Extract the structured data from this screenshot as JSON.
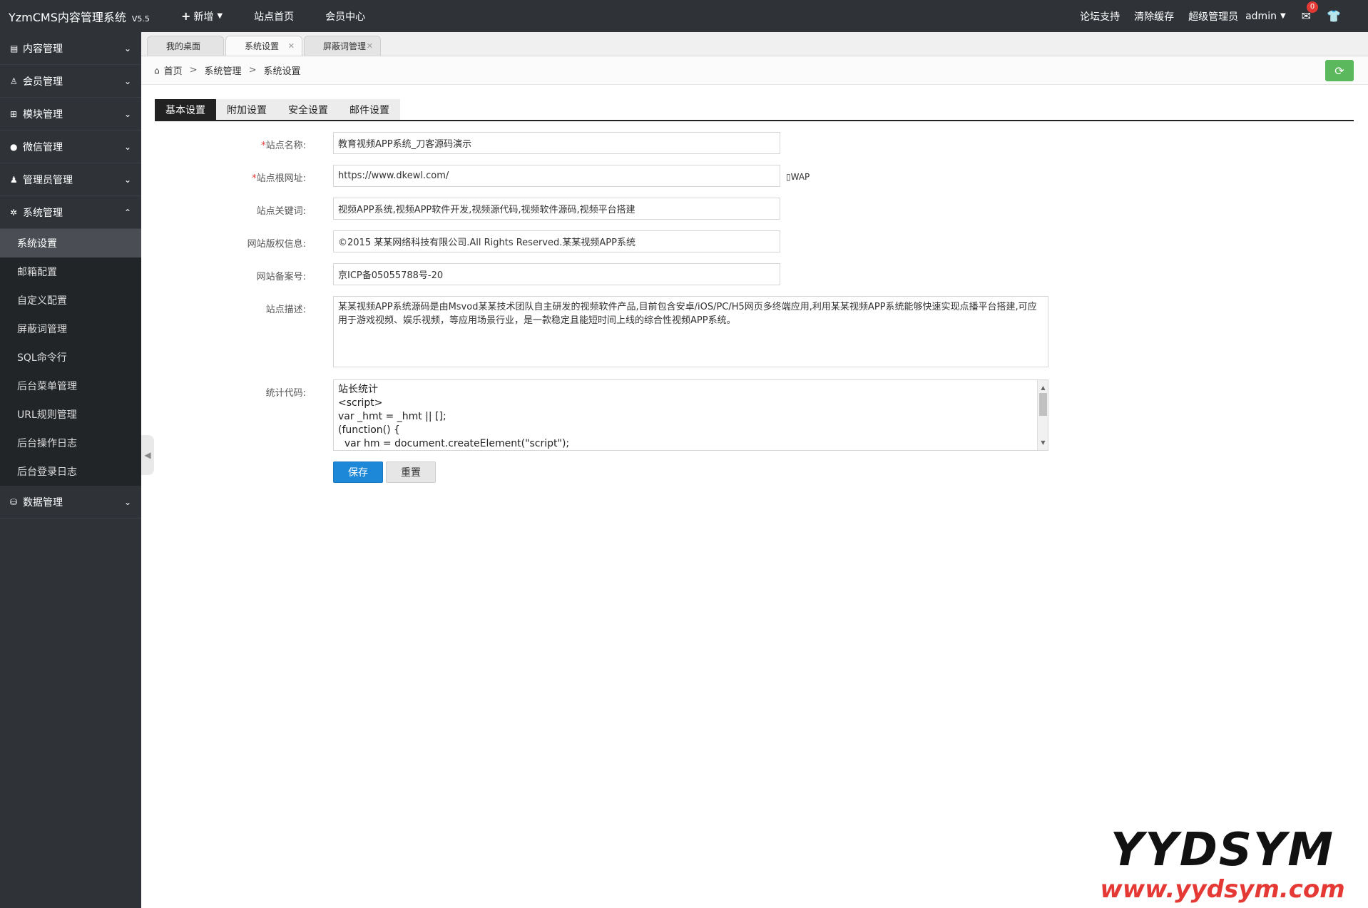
{
  "topbar": {
    "brand": "YzmCMS内容管理系统",
    "version": "V5.5",
    "nav": [
      {
        "label": "新增",
        "icon": "plus-icon"
      },
      {
        "label": "站点首页"
      },
      {
        "label": "会员中心"
      }
    ],
    "right": {
      "forum": "论坛支持",
      "clear_cache": "清除缓存",
      "role": "超级管理员",
      "user": "admin",
      "mail_badge": "0"
    }
  },
  "sidebar": {
    "groups": [
      {
        "label": "内容管理",
        "icon": "list-icon"
      },
      {
        "label": "会员管理",
        "icon": "user-icon"
      },
      {
        "label": "模块管理",
        "icon": "grid-icon"
      },
      {
        "label": "微信管理",
        "icon": "wechat-icon"
      },
      {
        "label": "管理员管理",
        "icon": "admin-user-icon"
      },
      {
        "label": "系统管理",
        "icon": "gear-icon"
      }
    ],
    "system_items": [
      "系统设置",
      "邮箱配置",
      "自定义配置",
      "屏蔽词管理",
      "SQL命令行",
      "后台菜单管理",
      "URL规则管理",
      "后台操作日志",
      "后台登录日志"
    ],
    "active_item": "系统设置",
    "data_group": {
      "label": "数据管理",
      "icon": "database-icon"
    }
  },
  "page_tabs": [
    {
      "label": "我的桌面"
    },
    {
      "label": "系统设置"
    },
    {
      "label": "屏蔽词管理"
    }
  ],
  "breadcrumb": [
    "首页",
    "系统管理",
    "系统设置"
  ],
  "settings_tabs": [
    "基本设置",
    "附加设置",
    "安全设置",
    "邮件设置"
  ],
  "form": {
    "site_name": {
      "label": "站点名称:",
      "value": "教育视频APP系统_刀客源码演示",
      "required": "*"
    },
    "site_url": {
      "label": "站点根网址:",
      "value": "https://www.dkewl.com/",
      "required": "*",
      "wap": "WAP"
    },
    "keywords": {
      "label": "站点关键词:",
      "value": "视频APP系统,视频APP软件开发,视频源代码,视频软件源码,视频平台搭建"
    },
    "copyright": {
      "label": "网站版权信息:",
      "value": "©2015 某某网络科技有限公司.All Rights Reserved.某某视频APP系统"
    },
    "icp": {
      "label": "网站备案号:",
      "value": "京ICP备05055788号-20"
    },
    "description": {
      "label": "站点描述:",
      "value": "某某视频APP系统源码是由Msvod某某技术团队自主研发的视频软件产品,目前包含安卓/iOS/PC/H5网页多终端应用,利用某某视频APP系统能够快速实现点播平台搭建,可应用于游戏视频、娱乐视频，等应用场景行业，是一款稳定且能短时间上线的综合性视频APP系统。"
    },
    "stats": {
      "label": "统计代码:",
      "lines": [
        "站长统计",
        "<script>",
        "var _hmt = _hmt || [];",
        "(function() {",
        "  var hm = document.createElement(\"script\");"
      ]
    },
    "save": "保存",
    "reset": "重置"
  },
  "watermark": {
    "big": "YYDSYM",
    "small": "www.yydsym.com"
  }
}
